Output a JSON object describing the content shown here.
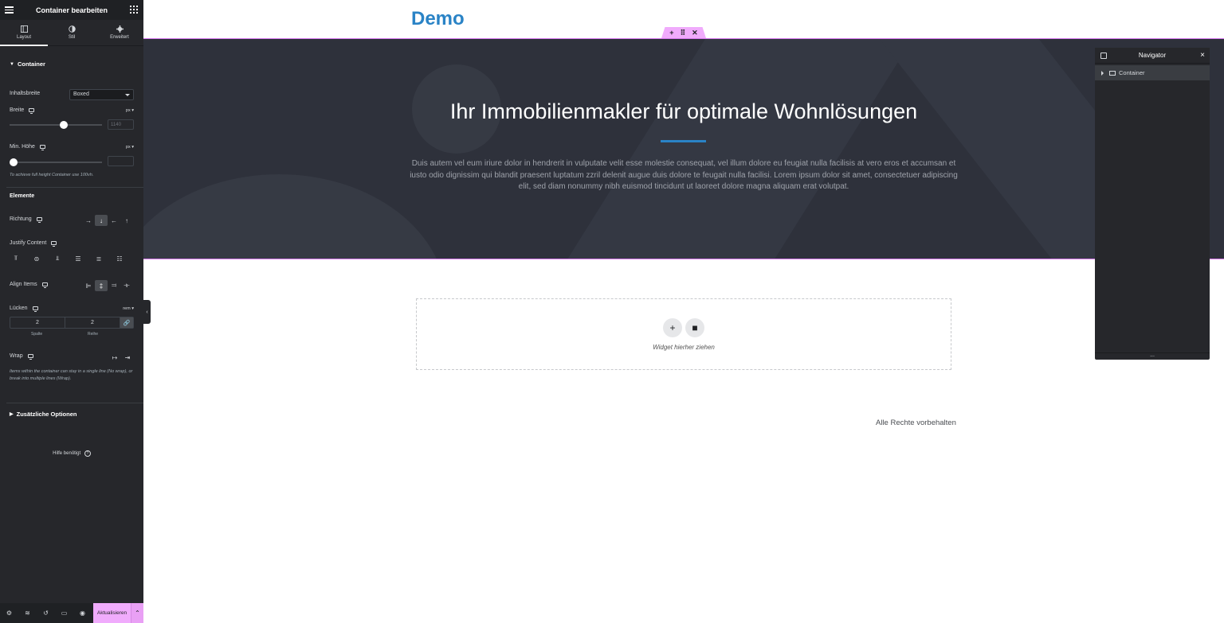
{
  "sidebar": {
    "title": "Container bearbeiten",
    "tabs": [
      {
        "label": "Layout",
        "icon": "layout-icon"
      },
      {
        "label": "Stil",
        "icon": "style-contrast-icon"
      },
      {
        "label": "Erweitert",
        "icon": "gear-icon"
      }
    ],
    "section_container": "Container",
    "content_width": {
      "label": "Inhaltsbreite",
      "value": "Boxed"
    },
    "width": {
      "label": "Breite",
      "unit": "px",
      "placeholder": "1140",
      "slider_fraction": 0.59
    },
    "min_height": {
      "label": "Min. Höhe",
      "unit": "px",
      "value": "",
      "slider_fraction": 0.0
    },
    "min_height_hint": "To achieve full height Container use 100vh.",
    "elements_heading": "Elemente",
    "direction": {
      "label": "Richtung",
      "options": [
        "→",
        "↓",
        "←",
        "↑"
      ],
      "selected": 1
    },
    "justify_content": {
      "label": "Justify Content"
    },
    "align_items": {
      "label": "Align Items",
      "selected": 1
    },
    "gaps": {
      "label": "Lücken",
      "unit": "rem",
      "column_value": "2",
      "row_value": "2",
      "column_label": "Spalte",
      "row_label": "Reihe"
    },
    "wrap": {
      "label": "Wrap"
    },
    "wrap_hint": "Items within the container can stay in a single line (No wrap), or break into multiple lines (Wrap).",
    "extra_options": "Zusätzliche Optionen",
    "help": "Hilfe benötigt"
  },
  "footer": {
    "update_label": "Aktualisieren"
  },
  "canvas": {
    "logo": "Demo",
    "hero_title": "Ihr Immobilienmakler für optimale Wohnlösungen",
    "hero_text": "Duis autem vel eum iriure dolor in hendrerit in vulputate velit esse molestie consequat, vel illum dolore eu feugiat nulla facilisis at vero eros et accumsan et iusto odio dignissim qui blandit praesent luptatum zzril delenit augue duis dolore te feugait nulla facilisi. Lorem ipsum dolor sit amet, consectetuer adipiscing elit, sed diam nonummy nibh euismod tincidunt ut laoreet dolore magna aliquam erat volutpat.",
    "dropzone_text": "Widget hierher ziehen",
    "footer_text": "Alle Rechte vorbehalten"
  },
  "navigator": {
    "title": "Navigator",
    "items": [
      {
        "label": "Container"
      }
    ]
  },
  "colors": {
    "accent_pink": "#f0abfc",
    "brand_blue": "#2a83c6",
    "hero_bg": "#2e313b",
    "panel_bg": "#26272b"
  }
}
